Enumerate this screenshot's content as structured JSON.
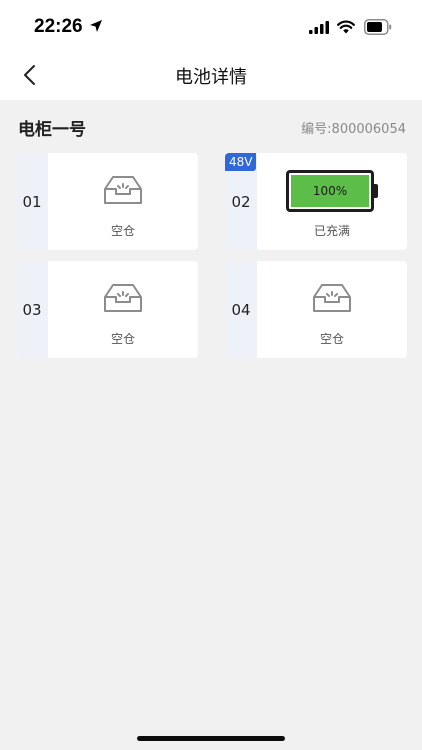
{
  "status_bar": {
    "time": "22:26",
    "icons": [
      "location-arrow-icon",
      "cellular-signal-icon",
      "wifi-icon",
      "battery-icon"
    ]
  },
  "nav": {
    "title": "电池详情",
    "back_icon": "chevron-left-icon"
  },
  "cabinet": {
    "name": "电柜一号",
    "serial": "编号:800006054"
  },
  "slots": [
    {
      "number": "01",
      "status": "空仓",
      "state": "empty",
      "icon": "empty-tray-icon"
    },
    {
      "number": "02",
      "status": "已充满",
      "state": "battery",
      "voltage": "48V",
      "charge_label": "100%",
      "charge_fraction": 1.0,
      "icon": "battery-icon"
    },
    {
      "number": "03",
      "status": "空仓",
      "state": "empty",
      "icon": "empty-tray-icon"
    },
    {
      "number": "04",
      "status": "空仓",
      "state": "empty",
      "icon": "empty-tray-icon"
    }
  ],
  "colors": {
    "voltage_badge": "#2f68d8",
    "battery_fill": "#5cbe49",
    "slot_number_bg": "#eef1f8",
    "page_bg": "#f0f1f0"
  }
}
